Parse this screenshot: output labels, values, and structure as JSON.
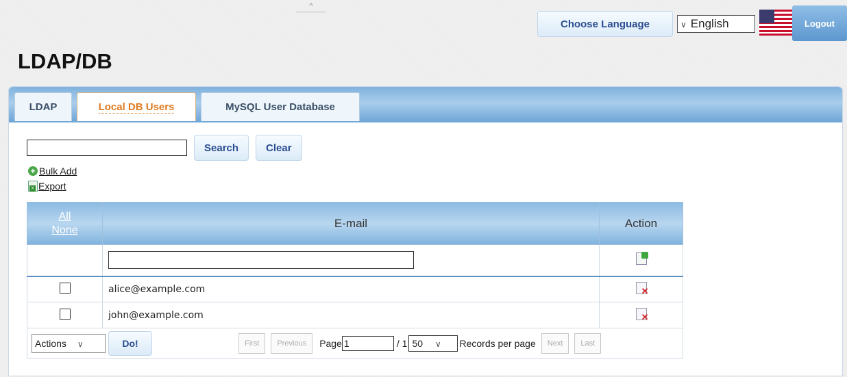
{
  "header": {
    "choose_language": "Choose Language",
    "language_value": "English",
    "logout": "Logout"
  },
  "page_title": "LDAP/DB",
  "tabs": [
    {
      "label": "LDAP"
    },
    {
      "label": "Local DB Users",
      "active": true
    },
    {
      "label": "MySQL User Database"
    }
  ],
  "toolbar": {
    "search": "Search",
    "clear": "Clear",
    "bulk_add": "Bulk Add",
    "export": "Export"
  },
  "table": {
    "select_all": "All",
    "select_none": "None",
    "col_email": "E-mail",
    "col_action": "Action",
    "rows": [
      {
        "email": "alice@example.com"
      },
      {
        "email": "john@example.com"
      }
    ]
  },
  "footer": {
    "actions": "Actions",
    "do": "Do!",
    "first": "First",
    "previous": "Previous",
    "page_label": "Page",
    "page_value": "1",
    "page_total": "/ 1",
    "per_page_value": "50",
    "records_per_page": "Records per page",
    "next": "Next",
    "last": "Last"
  },
  "colors": {
    "accent_tab": "#e07a1f",
    "header_blue": "#7fb2dd",
    "button_text": "#2a4d8f"
  }
}
